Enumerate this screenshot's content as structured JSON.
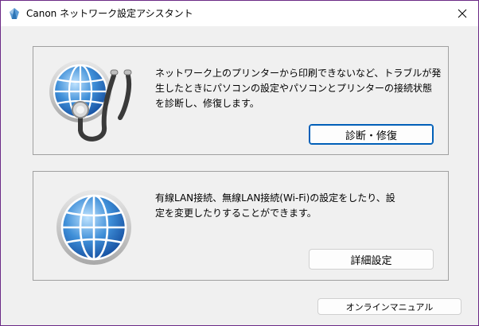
{
  "window": {
    "title": "Canon ネットワーク設定アシスタント",
    "app_icon": "canon-app-icon",
    "close_icon": "close-icon",
    "accent_color": "#6b2a86"
  },
  "diagnose": {
    "icon": "globe-stethoscope-icon",
    "description_line1": "ネットワーク上のプリンターから印刷できないなど、トラブルが発",
    "description_line2": "生したときにパソコンの設定やパソコンとプリンターの接続状態",
    "description_line3": "を診断し、修復します。",
    "button_label": "診断・修復"
  },
  "advanced": {
    "icon": "globe-icon",
    "description_line1": "有線LAN接続、無線LAN接続(Wi-Fi)の設定をしたり、設",
    "description_line2": "定を変更したりすることができます。",
    "button_label": "詳細設定"
  },
  "footer": {
    "manual_button_label": "オンラインマニュアル"
  }
}
